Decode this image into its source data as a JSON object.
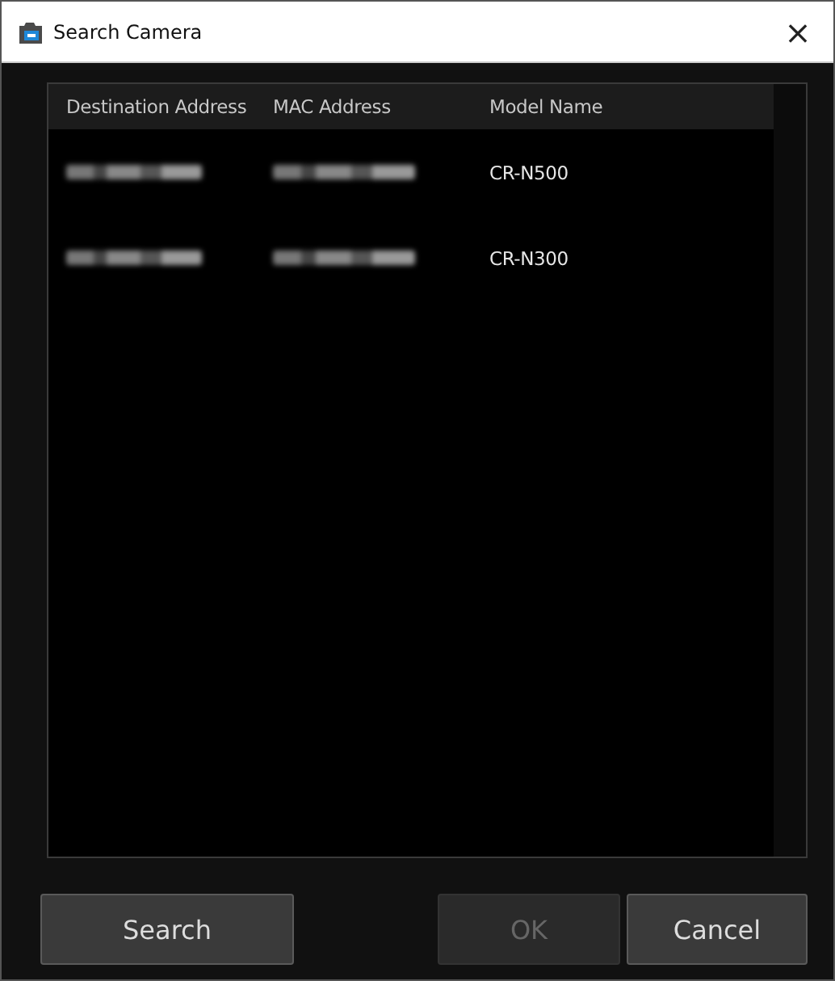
{
  "window": {
    "title": "Search Camera",
    "close": "×"
  },
  "table": {
    "columns": [
      "Destination Address",
      "MAC Address",
      "Model Name"
    ],
    "rows": [
      {
        "model_name": "CR-N500"
      },
      {
        "model_name": "CR-N300"
      }
    ]
  },
  "buttons": [
    {
      "label": "Search",
      "disabled": false
    },
    {
      "label": "OK",
      "disabled": true
    },
    {
      "label": "Cancel",
      "disabled": false
    }
  ]
}
